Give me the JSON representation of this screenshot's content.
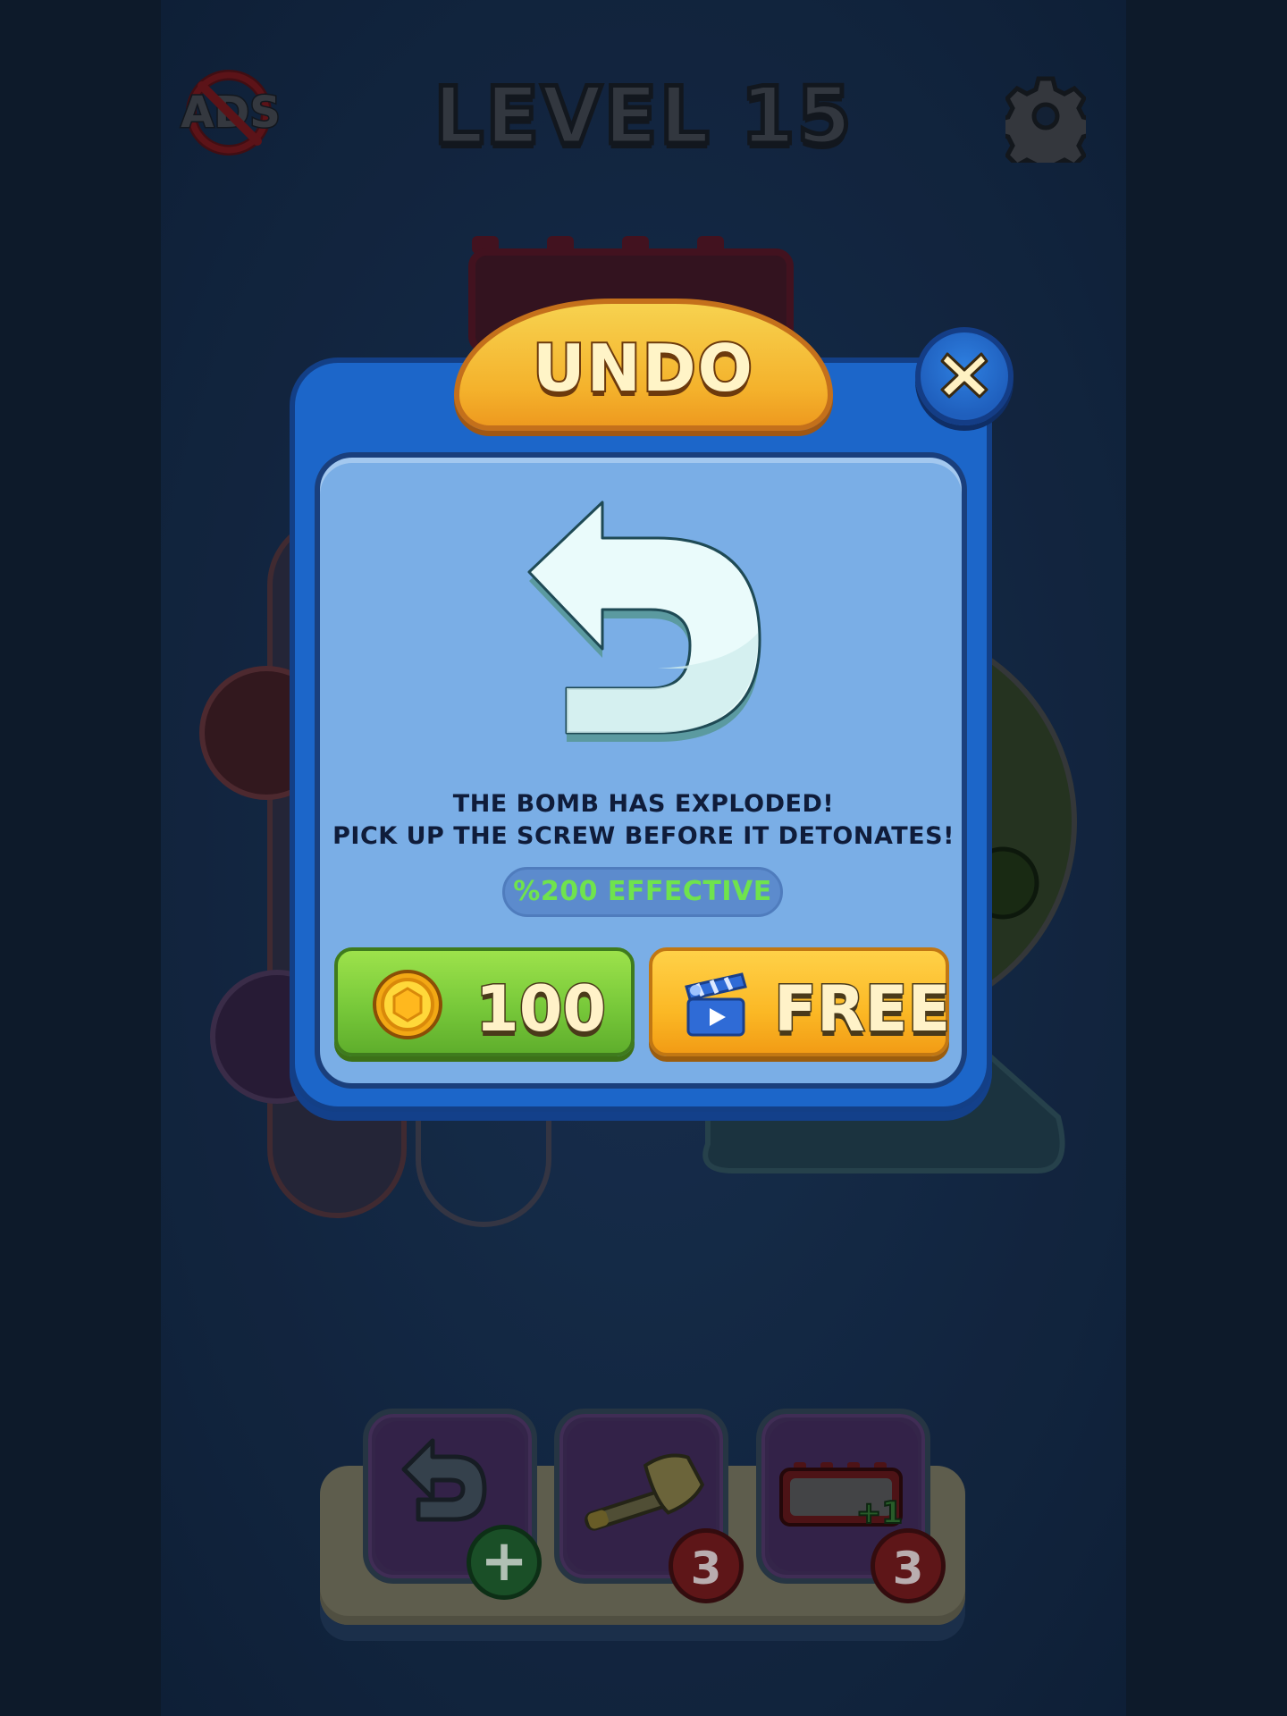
{
  "hud": {
    "level_label": "LEVEL 15",
    "no_ads_label": "ADS"
  },
  "modal": {
    "title": "UNDO",
    "description_line1": "THE BOMB HAS EXPLODED!",
    "description_line2": "PICK UP THE SCREW BEFORE IT DETONATES!",
    "effective_label": "%200 EFFECTIVE",
    "coin_button_label": "100",
    "free_button_label": "FREE"
  },
  "tools": [
    {
      "name": "undo",
      "badge": "+"
    },
    {
      "name": "hammer",
      "badge": "3"
    },
    {
      "name": "extra-slot",
      "badge": "3",
      "overlay_text": "+1"
    }
  ],
  "colors": {
    "modal_frame": "#1c66c9",
    "modal_panel": "#7aaee6",
    "title_pill": "#f4b22c",
    "green_button": "#78c93a",
    "yellow_button": "#fbb825",
    "effective_text": "#6fe34d"
  }
}
